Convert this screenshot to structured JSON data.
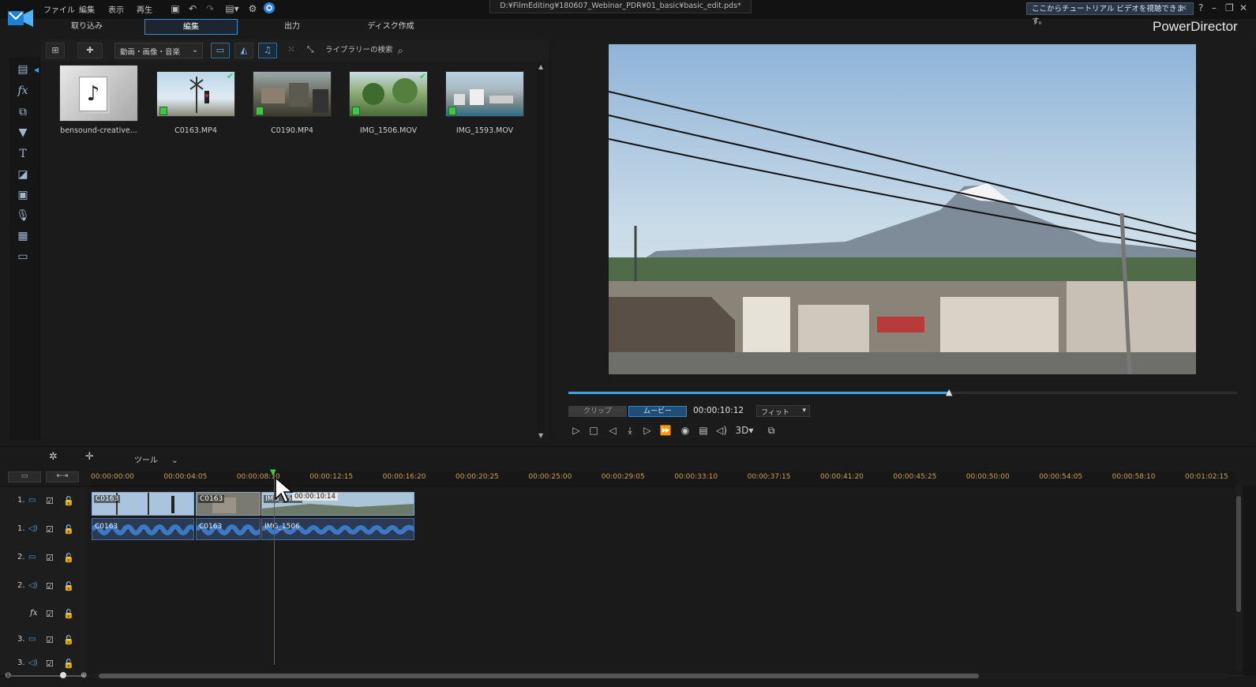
{
  "menubar": {
    "items": [
      "ファイル",
      "編集",
      "表示",
      "再生"
    ],
    "file_path": "D:¥FilmEditing¥180607_Webinar_PDR¥01_basic¥basic_edit.pds*",
    "tutorial_text": "ここからチュートリアル ビデオを視聴できます。",
    "close_glyph": "×",
    "win_controls": [
      "?",
      "–",
      "❐",
      "✕"
    ]
  },
  "tabs": {
    "capture": "取り込み",
    "edit": "編集",
    "produce": "出力",
    "disc": "ディスク作成"
  },
  "brand": "PowerDirector",
  "library": {
    "media_filter": "動画・画像・音楽",
    "search_placeholder": "ライブラリーの検索",
    "items": [
      {
        "label": "bensound-creative..."
      },
      {
        "label": "C0163.MP4"
      },
      {
        "label": "C0190.MP4"
      },
      {
        "label": "IMG_1506.MOV"
      },
      {
        "label": "IMG_1593.MOV"
      }
    ]
  },
  "preview": {
    "clip_label": "クリップ",
    "movie_label": "ムービー",
    "timecode": "00:00:10:12",
    "fit_label": "フィット",
    "three_d": "3D",
    "progress": 0.5708
  },
  "timeline": {
    "tools_label": "ツール",
    "ticks": [
      "00:00:00:00",
      "00:00:04:05",
      "00:00:08:10",
      "00:00:12:15",
      "00:00:16:20",
      "00:00:20:25",
      "00:00:25:00",
      "00:00:29:05",
      "00:00:33:10",
      "00:00:37:15",
      "00:00:41:20",
      "00:00:45:25",
      "00:00:50:00",
      "00:00:54:05",
      "00:00:58:10",
      "00:01:02:15"
    ],
    "tooltip": "00:00:10:14",
    "tracks": [
      {
        "num": "1.",
        "kind": "video"
      },
      {
        "num": "1.",
        "kind": "audio"
      },
      {
        "num": "2.",
        "kind": "video"
      },
      {
        "num": "2.",
        "kind": "audio"
      },
      {
        "num": "",
        "kind": "fx"
      },
      {
        "num": "3.",
        "kind": "video"
      },
      {
        "num": "3.",
        "kind": "audio"
      }
    ],
    "video_clips": [
      "C0163",
      "C0163",
      "IMG_1506"
    ],
    "audio_clips": [
      "C0163",
      "C0163",
      "IMG_1506"
    ]
  },
  "colors": {
    "accent": "#2f8fd8",
    "playhead": "#c53030",
    "check": "#39d34b",
    "ruler_text": "#c8a050"
  }
}
